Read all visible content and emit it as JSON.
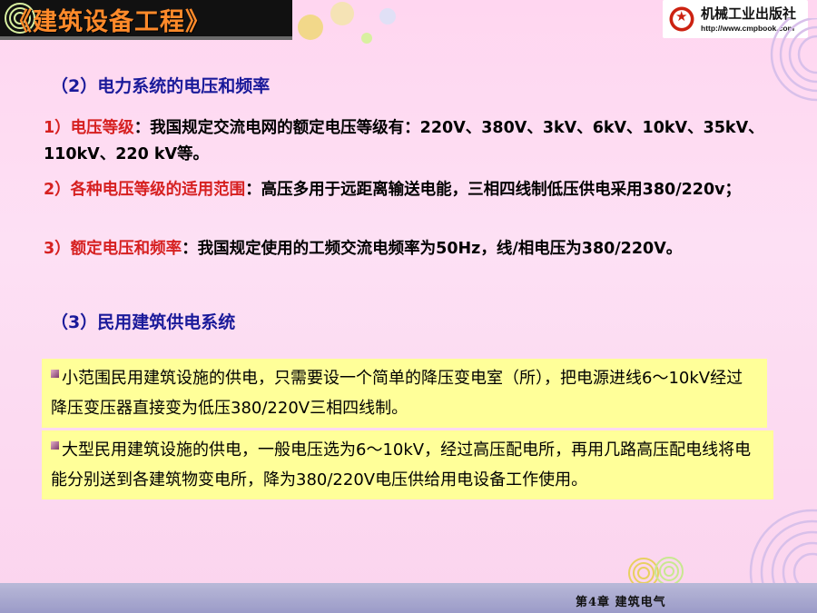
{
  "header": {
    "course_title": "《建筑设备工程》",
    "publisher_name": "机械工业出版社",
    "publisher_url": "http://www.cmpbook.com"
  },
  "sections": [
    {
      "heading": "（2）电力系统的电压和频率",
      "items": [
        {
          "key": "1）电压等级",
          "text": "：我国规定交流电网的额定电压等级有：220V、380V、3kV、6kV、10kV、35kV、110kV、220 kV等。"
        },
        {
          "key": "2）各种电压等级的适用范围",
          "text": "：高压多用于远距离输送电能，三相四线制低压供电采用380/220v；"
        },
        {
          "key": " 3）额定电压和频率",
          "text": "：我国规定使用的工频交流电频率为50Hz，线/相电压为380/220V。"
        }
      ]
    },
    {
      "heading": "（3）民用建筑供电系统",
      "boxes": [
        "小范围民用建筑设施的供电，只需要设一个简单的降压变电室（所），把电源进线6～10kV经过降压变压器直接变为低压380/220V三相四线制。",
        "大型民用建筑设施的供电，一般电压选为6～10kV，经过高压配电所，再用几路高压配电线将电能分别送到各建筑物变电所，降为380/220V电压供给用电设备工作使用。"
      ]
    }
  ],
  "footer": {
    "chapter": "第4章  建筑电气"
  },
  "colors": {
    "heading": "#1a1a9a",
    "key": "#d62020",
    "box_bg": "#ffff99",
    "title": "#ff8a2a"
  }
}
